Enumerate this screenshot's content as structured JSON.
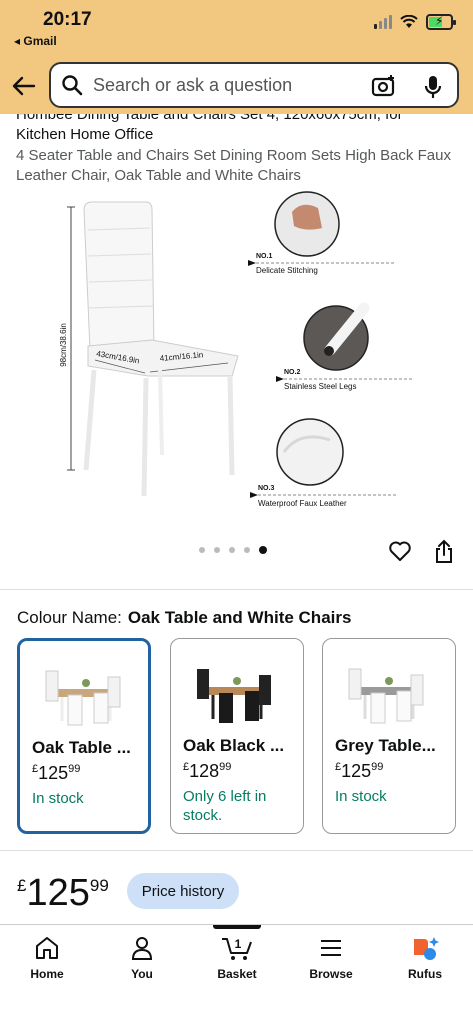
{
  "status_bar": {
    "time": "20:17",
    "back_app": "◂ Gmail"
  },
  "search": {
    "placeholder": "Search or ask a question"
  },
  "product": {
    "title_line1": "Hombee Dining Table and Chairs Set 4, 120x60x75cm, for",
    "title_line2": "Kitchen Home Office",
    "subtitle": "4 Seater Table and Chairs Set Dining Room Sets High Back Faux Leather Chair, Oak Table and White Chairs"
  },
  "image_annotations": {
    "height": "98cm/38.6in",
    "depth": "43cm/16.9in",
    "width": "41cm/16.1in",
    "features": [
      {
        "num": "NO.1",
        "label": "Delicate Stitching"
      },
      {
        "num": "NO.2",
        "label": "Stainless Steel Legs"
      },
      {
        "num": "NO.3",
        "label": "Waterproof Faux Leather"
      }
    ]
  },
  "carousel": {
    "total": 5,
    "active_index": 4
  },
  "colour": {
    "label": "Colour Name:",
    "selected": "Oak Table and White Chairs",
    "variants": [
      {
        "name": "Oak Table ...",
        "currency": "£",
        "whole": "125",
        "fraction": "99",
        "stock": "In stock"
      },
      {
        "name": "Oak Black ...",
        "currency": "£",
        "whole": "128",
        "fraction": "99",
        "stock": "Only 6 left in stock."
      },
      {
        "name": "Grey Table...",
        "currency": "£",
        "whole": "125",
        "fraction": "99",
        "stock": "In stock"
      }
    ]
  },
  "price": {
    "currency": "£",
    "whole": "125",
    "fraction": "99",
    "history_label": "Price history"
  },
  "nav": {
    "home": "Home",
    "you": "You",
    "basket": "Basket",
    "basket_count": "1",
    "browse": "Browse",
    "rufus": "Rufus"
  },
  "colors": {
    "header_bg": "#f2c77f",
    "selected_border": "#2162a1",
    "in_stock": "#067d62",
    "price_history_bg": "#cde0f7"
  }
}
